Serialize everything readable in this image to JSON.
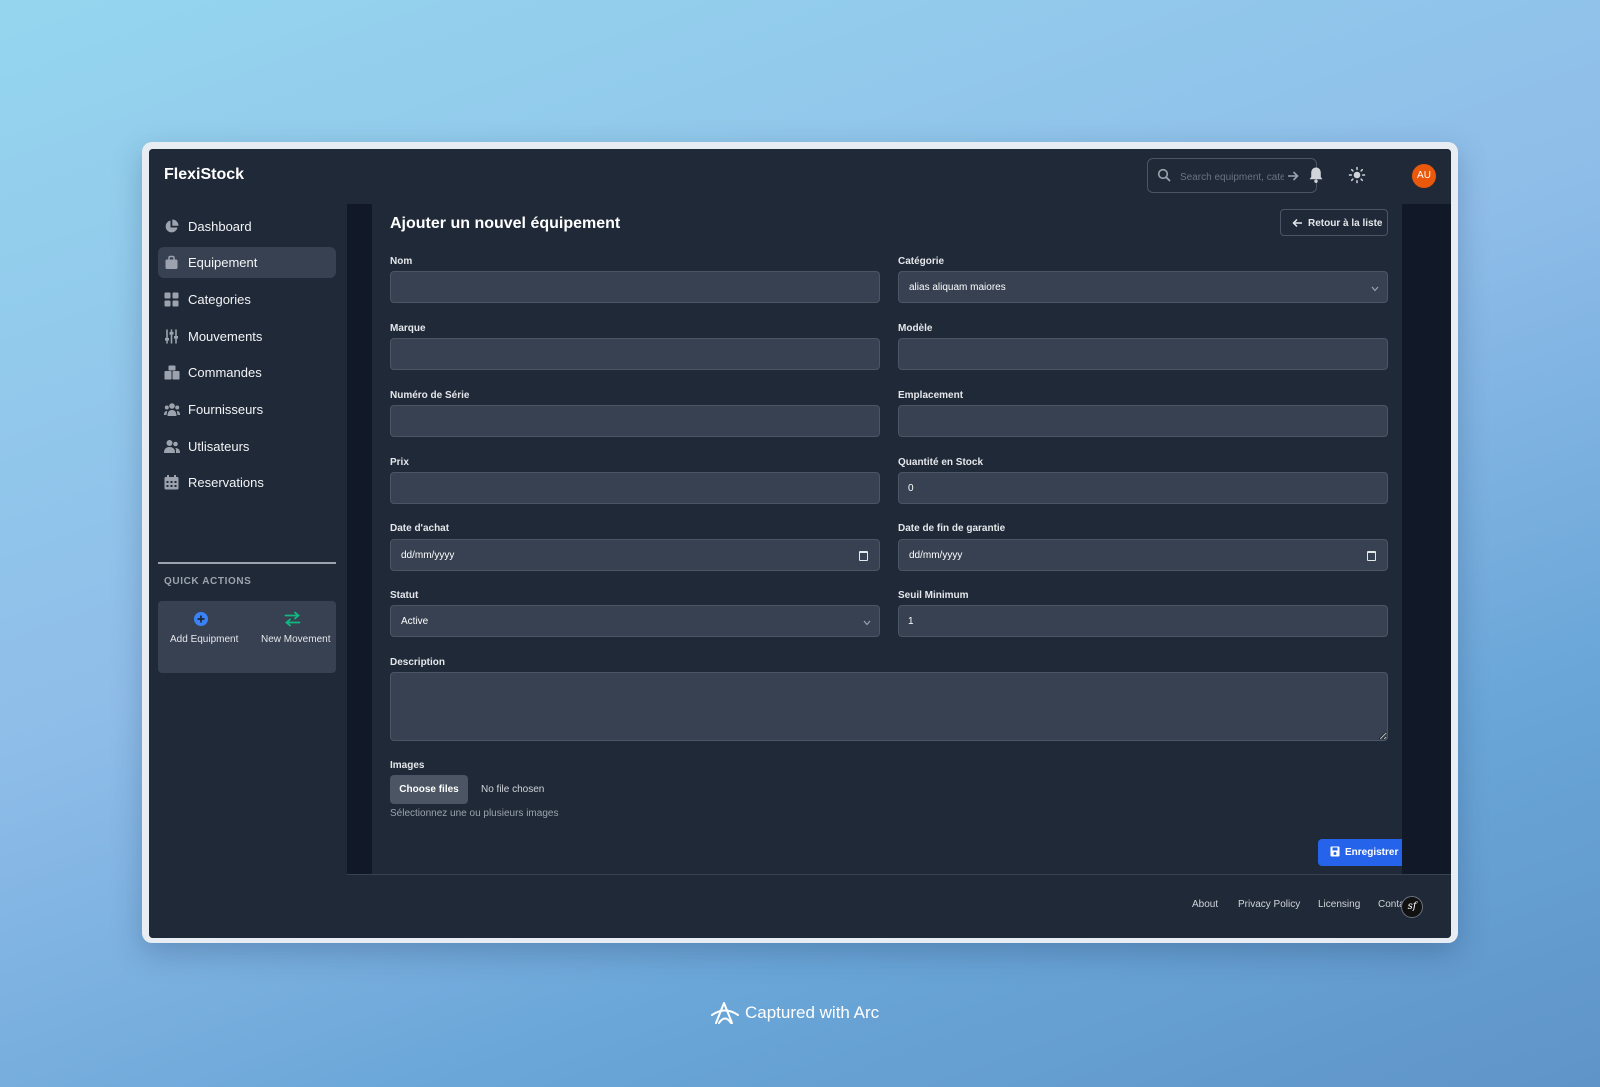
{
  "app": {
    "brand": "FlexiStock"
  },
  "header": {
    "search_placeholder": "Search equipment, cate",
    "avatar_initials": "AU"
  },
  "sidebar": {
    "items": [
      {
        "label": "Dashboard",
        "icon": "pie-chart-icon",
        "active": false
      },
      {
        "label": "Equipement",
        "icon": "briefcase-icon",
        "active": true
      },
      {
        "label": "Categories",
        "icon": "grid-icon",
        "active": false
      },
      {
        "label": "Mouvements",
        "icon": "sliders-icon",
        "active": false
      },
      {
        "label": "Commandes",
        "icon": "boxes-icon",
        "active": false
      },
      {
        "label": "Fournisseurs",
        "icon": "users-group-icon",
        "active": false
      },
      {
        "label": "Utlisateurs",
        "icon": "users-icon",
        "active": false
      },
      {
        "label": "Reservations",
        "icon": "calendar-icon",
        "active": false
      }
    ],
    "quick_actions_title": "QUICK ACTIONS",
    "quick_actions": [
      {
        "label": "Add Equipment",
        "icon": "plus-circle-icon",
        "color": "#3b82f6"
      },
      {
        "label": "New Movement",
        "icon": "exchange-icon",
        "color": "#10b981"
      }
    ]
  },
  "page": {
    "title": "Ajouter un nouvel équipement",
    "back_label": "Retour à la liste"
  },
  "form": {
    "nom": {
      "label": "Nom",
      "value": ""
    },
    "categorie": {
      "label": "Catégorie",
      "value": "alias aliquam maiores"
    },
    "marque": {
      "label": "Marque",
      "value": ""
    },
    "modele": {
      "label": "Modèle",
      "value": ""
    },
    "numero_serie": {
      "label": "Numéro de Série",
      "value": ""
    },
    "emplacement": {
      "label": "Emplacement",
      "value": ""
    },
    "prix": {
      "label": "Prix",
      "value": ""
    },
    "quantite": {
      "label": "Quantité en Stock",
      "value": "0"
    },
    "date_achat": {
      "label": "Date d'achat",
      "placeholder": "dd/mm/yyyy"
    },
    "date_garantie": {
      "label": "Date de fin de garantie",
      "placeholder": "dd/mm/yyyy"
    },
    "statut": {
      "label": "Statut",
      "value": "Active"
    },
    "seuil": {
      "label": "Seuil Minimum",
      "value": "1"
    },
    "description": {
      "label": "Description",
      "value": ""
    },
    "images": {
      "label": "Images",
      "button": "Choose files",
      "status": "No file chosen",
      "help": "Sélectionnez une ou plusieurs images"
    },
    "submit": "Enregistrer"
  },
  "footer": {
    "links": [
      "About",
      "Privacy Policy",
      "Licensing",
      "Conta"
    ],
    "badge": "sf"
  },
  "watermark": "Captured with Arc",
  "colors": {
    "accent": "#2563eb",
    "avatar": "#ea580c",
    "surface": "#1f2937",
    "field": "#374151"
  }
}
